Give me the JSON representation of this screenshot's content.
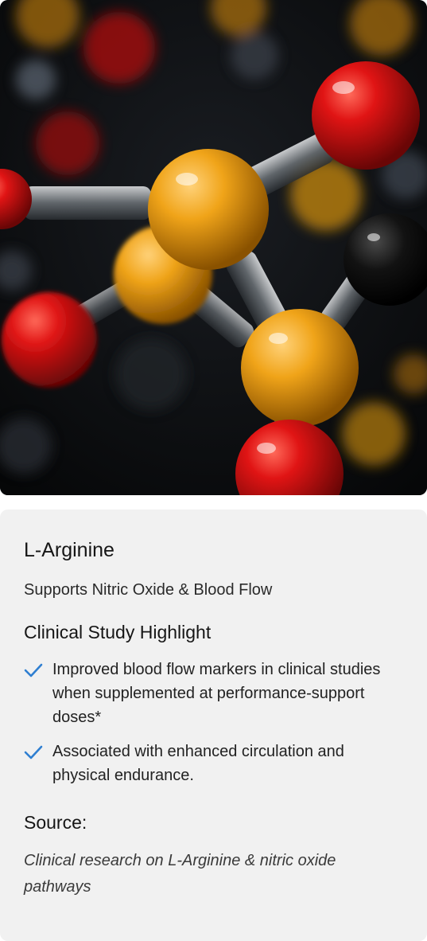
{
  "hero": {
    "image_description_icon": "molecule-illustration",
    "colors": {
      "oxygen": "#d41414",
      "sulfur": "#f0a419",
      "carbon": "#111111",
      "background": "#0b0d10"
    }
  },
  "card": {
    "title": "L-Arginine",
    "subtitle": "Supports Nitric Oxide & Blood Flow",
    "section_title": "Clinical Study Highlight",
    "check_color": "#2f7fd1",
    "bullets": [
      {
        "icon": "check-icon",
        "text": "Improved blood flow markers in clinical studies when supplemented at performance-support doses*"
      },
      {
        "icon": "check-icon",
        "text": "Associated with enhanced circulation and physical endurance."
      }
    ],
    "source_title": "Source:",
    "source_text": "Clinical research on L-Arginine & nitric oxide pathways"
  }
}
